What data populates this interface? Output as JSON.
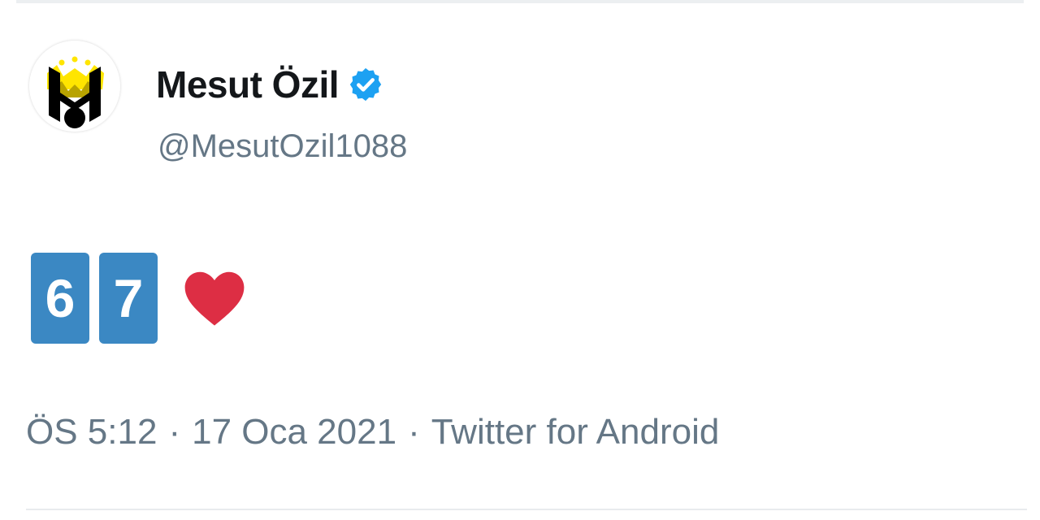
{
  "tweet": {
    "author": {
      "display_name": "Mesut Özil",
      "handle": "@MesutOzil1088",
      "verified": true,
      "avatar_icon": "m10-logo-icon"
    },
    "body": {
      "keycaps": [
        "6",
        "7"
      ],
      "emoji": "red-heart-icon"
    },
    "meta": {
      "time": "ÖS 5:12",
      "separator": "·",
      "date": "17 Oca 2021",
      "source": "Twitter for Android"
    }
  },
  "colors": {
    "text_primary": "#14171a",
    "text_secondary": "#657786",
    "verified_blue": "#1da1f2",
    "keycap_blue": "#3b88c3",
    "heart_red": "#dd2e44",
    "logo_yellow": "#ffe500"
  }
}
